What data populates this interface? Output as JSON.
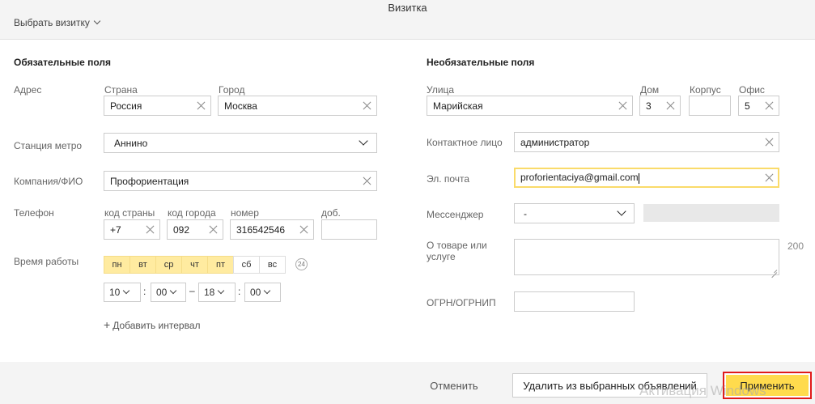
{
  "header": {
    "title": "Визитка",
    "select_card": "Выбрать визитку"
  },
  "required": {
    "title": "Обязательные поля",
    "address": {
      "label": "Адрес",
      "country_label": "Страна",
      "country": "Россия",
      "city_label": "Город",
      "city": "Москва"
    },
    "metro": {
      "label": "Станция метро",
      "value": "Аннино"
    },
    "company": {
      "label": "Компания/ФИО",
      "value": "Профориентация"
    },
    "phone": {
      "label": "Телефон",
      "country_code_label": "код страны",
      "country_code": "+7",
      "city_code_label": "код города",
      "city_code": "092",
      "number_label": "номер",
      "number": "316542546",
      "ext_label": "доб.",
      "ext": ""
    },
    "hours": {
      "label": "Время работы",
      "days": [
        {
          "label": "пн",
          "on": true
        },
        {
          "label": "вт",
          "on": true
        },
        {
          "label": "ср",
          "on": true
        },
        {
          "label": "чт",
          "on": true
        },
        {
          "label": "пт",
          "on": true
        },
        {
          "label": "сб",
          "on": false
        },
        {
          "label": "вс",
          "on": false
        }
      ],
      "badge": "24",
      "from_h": "10",
      "from_m": "00",
      "to_h": "18",
      "to_m": "00",
      "sep_colon": ":",
      "sep_dash": "–",
      "add_interval": "Добавить интервал"
    }
  },
  "optional": {
    "title": "Необязательные поля",
    "street": {
      "label": "Улица",
      "value": "Марийская"
    },
    "house": {
      "label": "Дом",
      "value": "3"
    },
    "building": {
      "label": "Корпус",
      "value": ""
    },
    "office": {
      "label": "Офис",
      "value": "5"
    },
    "contact": {
      "label": "Контактное лицо",
      "value": "администратор"
    },
    "email": {
      "label": "Эл. почта",
      "value": "proforientaciya@gmail.com"
    },
    "messenger": {
      "label": "Мессенджер",
      "value": "-"
    },
    "about": {
      "label": "О товаре или услуге",
      "counter": "200"
    },
    "ogrn": {
      "label": "ОГРН/ОГРНИП",
      "value": ""
    }
  },
  "footer": {
    "cancel": "Отменить",
    "remove": "Удалить из выбранных объявлений",
    "apply": "Применить"
  },
  "watermark": "Активация Windows",
  "colors": {
    "accent": "#ffdb4d",
    "highlight_border": "#e01b1b",
    "day_on": "#ffeba0"
  }
}
